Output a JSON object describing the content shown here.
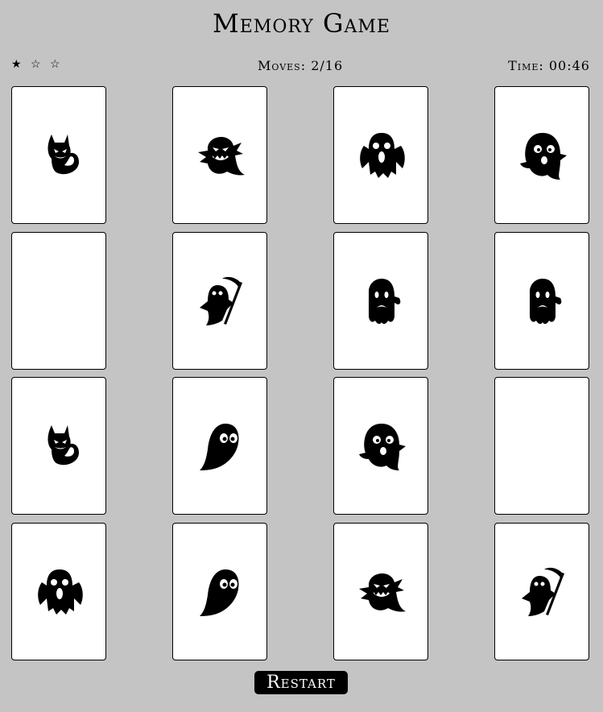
{
  "game": {
    "title": "Memory Game",
    "stars": [
      "★",
      "☆",
      "☆"
    ],
    "moves_label": "Moves: 2/16",
    "timer_label": "Time: 00:46",
    "restart_label": "Restart"
  },
  "cards": [
    {
      "icon": "devil-ghost-icon",
      "face_up": true
    },
    {
      "icon": "grinning-ghost-icon",
      "face_up": true
    },
    {
      "icon": "screaming-ghost-icon",
      "face_up": true
    },
    {
      "icon": "surprised-ghost-icon",
      "face_up": true
    },
    {
      "icon": "",
      "face_up": false
    },
    {
      "icon": "reaper-ghost-icon",
      "face_up": true
    },
    {
      "icon": "sad-ghost-icon",
      "face_up": true
    },
    {
      "icon": "sad-ghost-icon",
      "face_up": true
    },
    {
      "icon": "devil-ghost-icon",
      "face_up": true
    },
    {
      "icon": "simple-ghost-icon",
      "face_up": true
    },
    {
      "icon": "surprised-ghost-icon",
      "face_up": true
    },
    {
      "icon": "",
      "face_up": false
    },
    {
      "icon": "screaming-ghost-icon",
      "face_up": true
    },
    {
      "icon": "simple-ghost-icon",
      "face_up": true
    },
    {
      "icon": "grinning-ghost-icon",
      "face_up": true
    },
    {
      "icon": "reaper-ghost-icon",
      "face_up": true
    }
  ]
}
